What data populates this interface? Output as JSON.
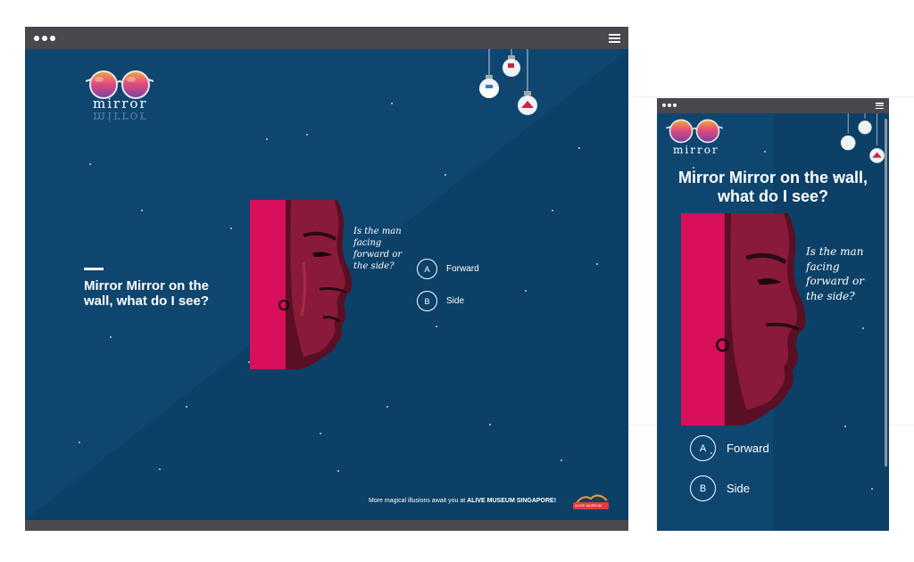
{
  "brand": {
    "logo_text": "mirror"
  },
  "quiz": {
    "title_desktop_line1": "Mirror Mirror on the",
    "title_desktop_line2": "wall, what do I see?",
    "title_mobile_line1": "Mirror Mirror on the wall,",
    "title_mobile_line2": "what do I see?",
    "question_line1": "Is the man",
    "question_line2": "facing",
    "question_line3": "forward or",
    "question_line4": "the side?",
    "options": [
      {
        "letter": "A",
        "label": "Forward"
      },
      {
        "letter": "B",
        "label": "Side"
      }
    ]
  },
  "footer": {
    "prefix": "More magical illusions await you at ",
    "highlight": "ALIVE MUSEUM SINGAPORE!",
    "badge": "ALIVE MUSEUM"
  },
  "colors": {
    "background": "#0f4670",
    "accent_magenta": "#d80f5a",
    "frame": "#4a4a4f",
    "text": "#ffffff"
  },
  "icons": [
    "glasses-icon",
    "hanging-bulb-icon",
    "menu-icon",
    "window-dots-icon"
  ]
}
